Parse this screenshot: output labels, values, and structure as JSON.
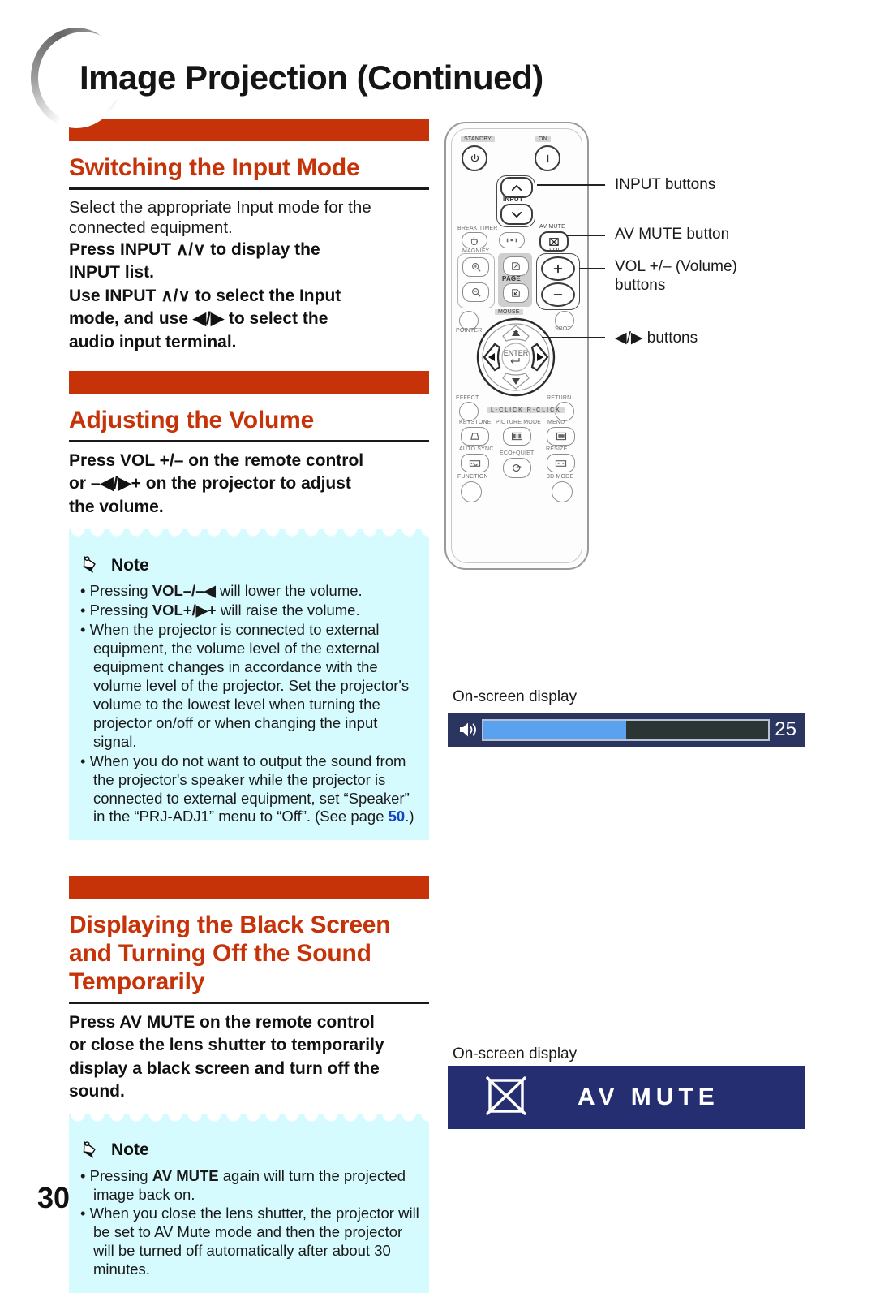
{
  "page": {
    "title": "Image Projection (Continued)",
    "number": "30"
  },
  "sections": [
    {
      "heading": "Switching the Input Mode",
      "intro": "Select the appropriate Input mode for the connected equipment.",
      "instruction_line1": "Press INPUT ∧/∨ to display the",
      "instruction_line2": "INPUT list.",
      "instruction_line3": "Use INPUT ∧/∨ to select the Input",
      "instruction_line4": "mode, and use ◀/▶ to select the",
      "instruction_line5": "audio input terminal."
    },
    {
      "heading": "Adjusting the Volume",
      "instruction_line1": "Press VOL +/– on the remote control",
      "instruction_line2": "or –◀/▶+ on the projector to adjust",
      "instruction_line3": "the volume.",
      "note": {
        "label": "Note",
        "items": [
          "Pressing VOL–/–◀ will lower the volume.",
          "Pressing VOL+/▶+ will raise the volume.",
          "When the projector is connected to external equipment, the volume level of the external equipment changes in accordance with the volume level of the projector. Set the projector's volume to the lowest level when turning the projector on/off or when changing the input signal.",
          "When you do not want to output the sound from the projector's speaker while the projector is connected to external equipment, set “Speaker” in the “PRJ-ADJ1” menu to “Off”. (See page 50.)"
        ],
        "page_ref": "50"
      }
    },
    {
      "heading_line1": "Displaying the Black Screen",
      "heading_line2": "and Turning Off the Sound",
      "heading_line3": "Temporarily",
      "instruction_line1": "Press AV MUTE on the remote control",
      "instruction_line2": "or close the lens shutter to temporarily",
      "instruction_line3": "display a black screen and turn off the",
      "instruction_line4": "sound.",
      "note": {
        "label": "Note",
        "items": [
          "Pressing AV MUTE again will turn the projected image back on.",
          "When you close the lens shutter, the projector will be set to AV Mute mode and then the projector will be turned off automatically after about 30 minutes."
        ]
      }
    }
  ],
  "remote": {
    "captions": {
      "standby": "STANDBY",
      "on": "ON",
      "input": "INPUT",
      "break_timer": "BREAK TIMER",
      "av_mute": "AV MUTE",
      "magnify": "MAGNIFY",
      "page": "PAGE",
      "vol": "VOL",
      "mouse": "MOUSE",
      "pointer": "POINTER",
      "spot": "SPOT",
      "enter": "ENTER",
      "effect": "EFFECT",
      "return": "RETURN",
      "keystone": "KEYSTONE",
      "l_click": "L-CLICK",
      "r_click": "R-CLICK",
      "click_bar": "L-CLICK     R-CLICK",
      "picture_mode": "PICTURE MODE",
      "menu": "MENU",
      "auto_sync": "AUTO SYNC",
      "eco_quiet": "ECO+QUIET",
      "resize": "RESIZE",
      "function": "FUNCTION",
      "mode_3d": "3D MODE"
    }
  },
  "callouts": [
    {
      "text": "INPUT buttons"
    },
    {
      "text": "AV MUTE button"
    },
    {
      "text_line1": "VOL +/– (Volume)",
      "text_line2": "buttons"
    },
    {
      "text": "◀/▶ buttons"
    }
  ],
  "osd": {
    "volume": {
      "caption": "On-screen display",
      "value": "25",
      "fill_percent": 50
    },
    "av_mute": {
      "caption": "On-screen display",
      "text": "AV MUTE"
    }
  },
  "colors": {
    "accent": "#c63309",
    "note_bg": "#d6fbff",
    "link_blue": "#1745c8",
    "osd_navy": "#2a3560",
    "osd_fill": "#5aa2f0",
    "mute_navy": "#252e70"
  }
}
